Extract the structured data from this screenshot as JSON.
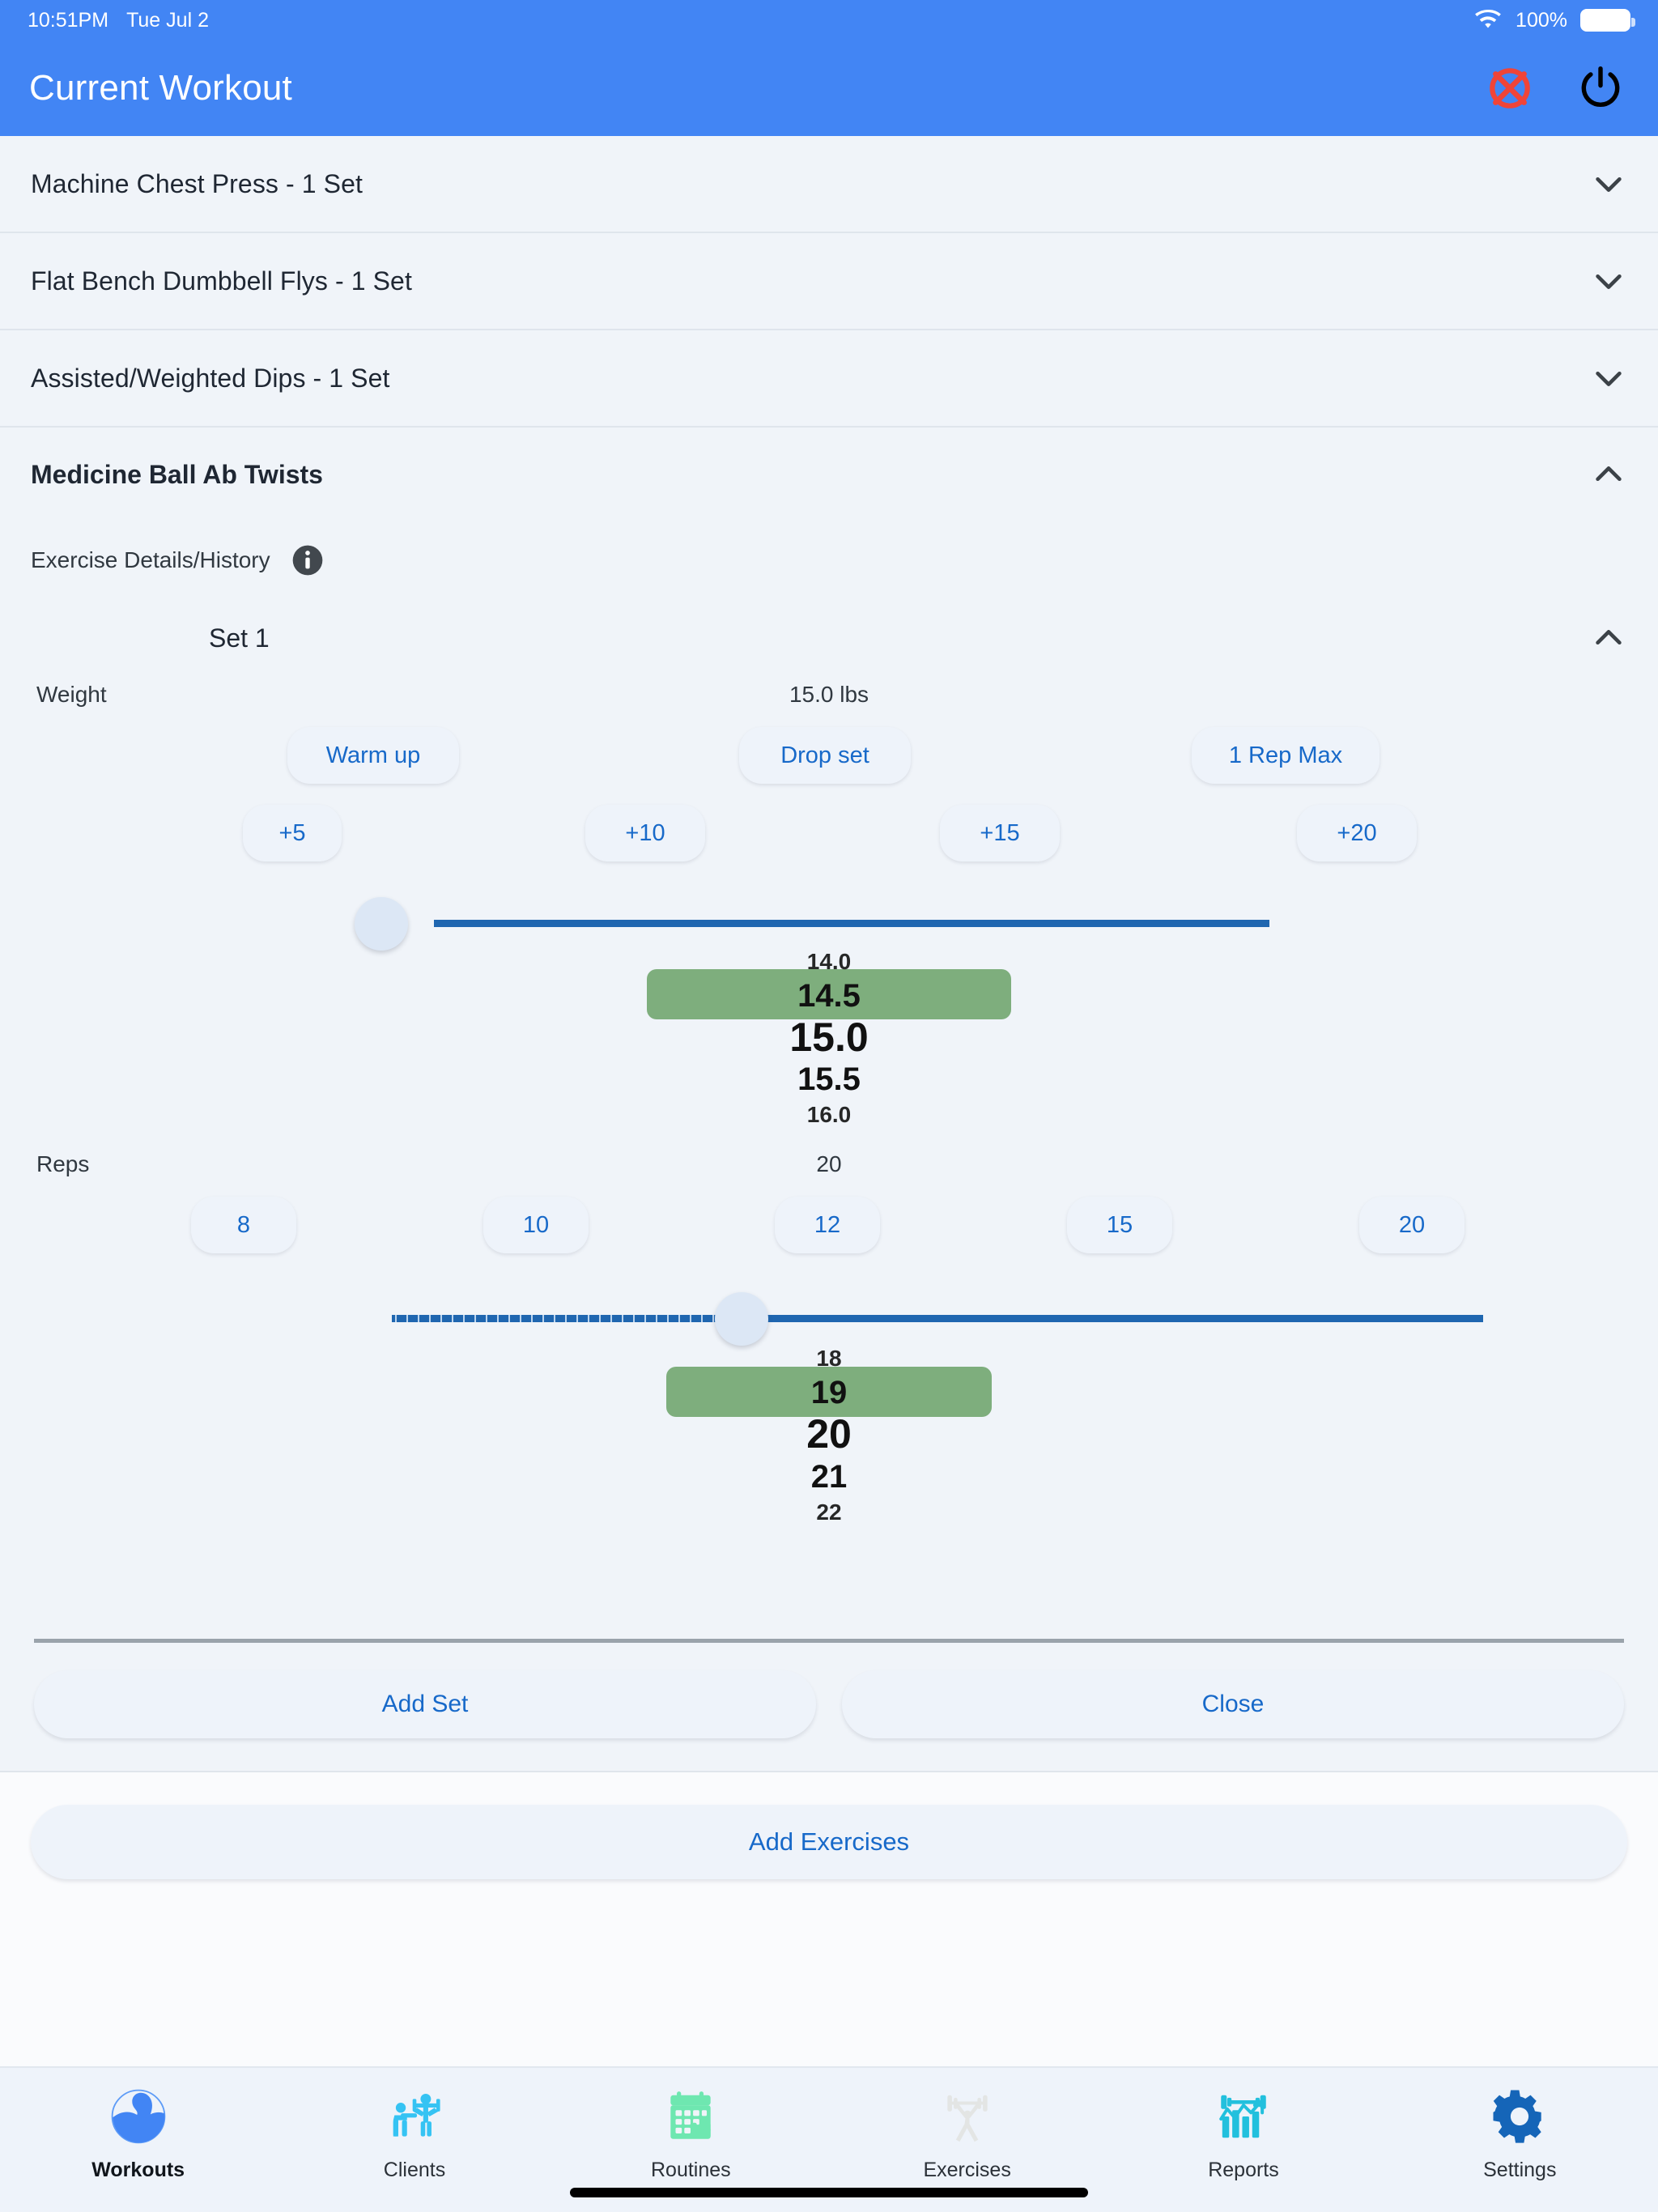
{
  "status_bar": {
    "time": "10:51PM",
    "date": "Tue Jul 2",
    "battery_percent": "100%",
    "wifi_icon": "wifi-icon",
    "battery_icon": "battery-full-icon"
  },
  "nav": {
    "title": "Current Workout",
    "cancel_icon": "cancel-circle-x-icon",
    "power_icon": "power-icon"
  },
  "exercises": [
    {
      "label": "Machine Chest Press - 1 Set",
      "chevron": "chevron-down-icon",
      "expanded": false
    },
    {
      "label": "Flat Bench Dumbbell Flys - 1 Set",
      "chevron": "chevron-down-icon",
      "expanded": false
    },
    {
      "label": "Assisted/Weighted Dips - 1 Set",
      "chevron": "chevron-down-icon",
      "expanded": false
    }
  ],
  "expanded_exercise": {
    "title": "Medicine Ball Ab Twists",
    "chevron": "chevron-up-icon",
    "details_label": "Exercise Details/History",
    "details_icon": "info-icon",
    "set": {
      "label": "Set 1",
      "chevron": "chevron-up-icon"
    },
    "weight": {
      "label": "Weight",
      "value_text": "15.0 lbs",
      "modifier_buttons": [
        "Warm up",
        "Drop set",
        "1 Rep Max"
      ],
      "increment_buttons": [
        "+5",
        "+10",
        "+15",
        "+20"
      ],
      "slider": {
        "percent": 2
      },
      "picker": {
        "options": [
          "14.0",
          "14.5",
          "15.0",
          "15.5",
          "16.0"
        ],
        "selected": "15.0",
        "selected_index": 2
      }
    },
    "reps": {
      "label": "Reps",
      "value_text": "20",
      "quick_buttons": [
        "8",
        "10",
        "12",
        "15",
        "20"
      ],
      "slider": {
        "percent": 40
      },
      "picker": {
        "options": [
          "18",
          "19",
          "20",
          "21",
          "22"
        ],
        "selected": "20",
        "selected_index": 2
      }
    },
    "actions": {
      "add_set": "Add Set",
      "close": "Close"
    }
  },
  "add_exercises_button": "Add Exercises",
  "tabs": [
    {
      "label": "Workouts",
      "icon": "muscle-arm-icon",
      "active": true
    },
    {
      "label": "Clients",
      "icon": "people-training-icon",
      "active": false
    },
    {
      "label": "Routines",
      "icon": "calendar-dumbbell-icon",
      "active": false
    },
    {
      "label": "Exercises",
      "icon": "weightlifter-icon",
      "active": false
    },
    {
      "label": "Reports",
      "icon": "barbell-chart-icon",
      "active": false
    },
    {
      "label": "Settings",
      "icon": "gear-icon",
      "active": false
    }
  ],
  "colors": {
    "brand_blue": "#4285f4",
    "link_blue": "#1769c9",
    "track_blue": "#1f66b0",
    "selected_green": "#7eae7d",
    "cancel_red": "#f04438",
    "panel_bg": "#f0f4f9",
    "page_bg": "#fafbfd"
  }
}
